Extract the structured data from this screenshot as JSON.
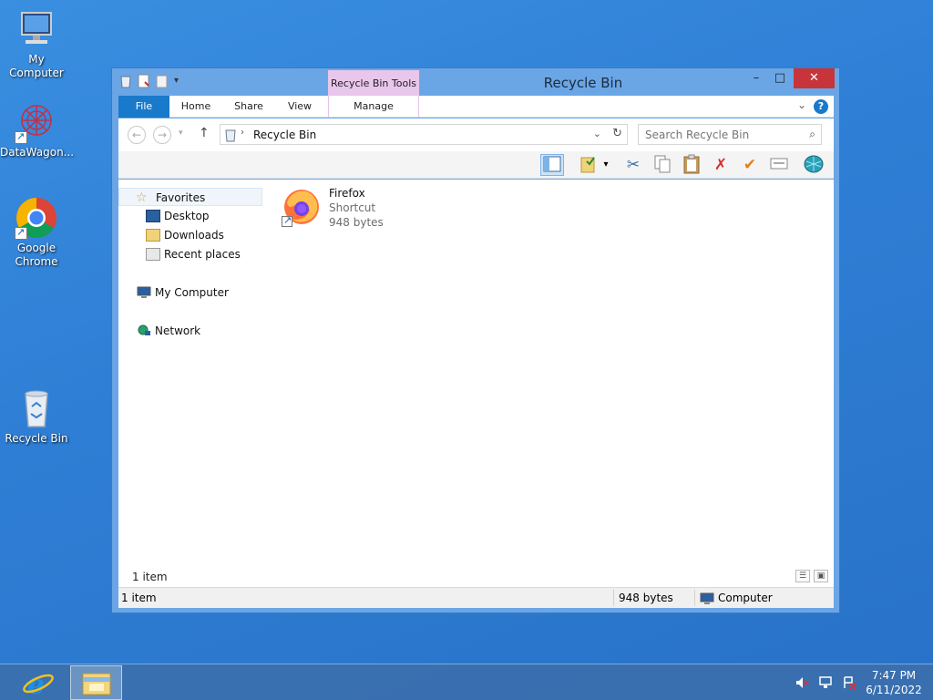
{
  "desktop": {
    "icons": [
      {
        "label": "My Computer"
      },
      {
        "label": "DataWagon..."
      },
      {
        "label": "Google Chrome"
      },
      {
        "label": "Recycle Bin"
      }
    ]
  },
  "window": {
    "title": "Recycle Bin",
    "context_tab": "Recycle Bin Tools",
    "minimize": "–",
    "maximize": "□",
    "close": "✕",
    "tabs": {
      "file": "File",
      "home": "Home",
      "share": "Share",
      "view": "View",
      "manage": "Manage"
    },
    "help": "?",
    "address": {
      "crumb": "Recycle Bin",
      "separator": "›"
    },
    "search": {
      "placeholder": "Search Recycle Bin"
    },
    "nav": {
      "favorites": "Favorites",
      "desktop": "Desktop",
      "downloads": "Downloads",
      "recent": "Recent places",
      "my_computer": "My Computer",
      "network": "Network"
    },
    "files": [
      {
        "name": "Firefox",
        "type": "Shortcut",
        "size": "948 bytes"
      }
    ],
    "item_count": "1 item",
    "status": {
      "items": "1 item",
      "size": "948 bytes",
      "location": "Computer"
    }
  },
  "taskbar": {
    "time": "7:47 PM",
    "date": "6/11/2022"
  },
  "colors": {
    "desktop_bg": "#2f7fd6",
    "file_tab": "#1979ca",
    "context_tab": "#e9c6ec",
    "close_btn": "#c7343a"
  }
}
